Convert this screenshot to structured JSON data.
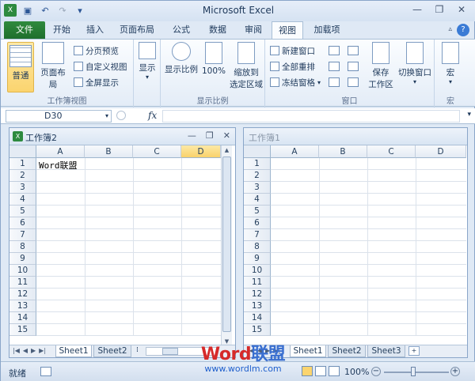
{
  "window": {
    "title": "Microsoft Excel"
  },
  "quick_access": {
    "save_icon": "save-icon",
    "undo_icon": "undo-icon",
    "redo_icon": "redo-icon",
    "customize_icon": "customize-qat-icon"
  },
  "ribbon_tabs": [
    {
      "label": "文件",
      "type": "file"
    },
    {
      "label": "开始"
    },
    {
      "label": "插入"
    },
    {
      "label": "页面布局"
    },
    {
      "label": "公式"
    },
    {
      "label": "数据"
    },
    {
      "label": "审阅"
    },
    {
      "label": "视图",
      "active": true
    },
    {
      "label": "加载项"
    }
  ],
  "ribbon": {
    "workbook_views": {
      "label": "工作簿视图",
      "normal": "普通",
      "page_layout": "页面布局",
      "page_break": "分页预览",
      "custom_view": "自定义视图",
      "full_screen": "全屏显示"
    },
    "show": {
      "label": "显示"
    },
    "zoom": {
      "label": "显示比例",
      "zoom": "显示比例",
      "hundred": "100%",
      "zoom_selection_line1": "缩放到",
      "zoom_selection_line2": "选定区域"
    },
    "window": {
      "label": "窗口",
      "new_window": "新建窗口",
      "arrange_all": "全部重排",
      "freeze_panes": "冻结窗格",
      "save_workspace_line1": "保存",
      "save_workspace_line2": "工作区",
      "switch_windows": "切换窗口"
    },
    "macros": {
      "label": "宏",
      "macros": "宏"
    }
  },
  "formula_bar": {
    "name_box": "D30",
    "fx": "fx",
    "content": ""
  },
  "workbooks": [
    {
      "title": "工作簿2",
      "active": true,
      "columns": [
        "A",
        "B",
        "C",
        "D"
      ],
      "selected_column": "D",
      "rows": [
        "1",
        "2",
        "3",
        "4",
        "5",
        "6",
        "7",
        "8",
        "9",
        "10",
        "11",
        "12",
        "13",
        "14",
        "15"
      ],
      "a1": "Word联盟",
      "sheets": [
        "Sheet1",
        "Sheet2"
      ],
      "active_sheet": "Sheet1"
    },
    {
      "title": "工作簿1",
      "active": false,
      "columns": [
        "A",
        "B",
        "C",
        "D"
      ],
      "rows": [
        "1",
        "2",
        "3",
        "4",
        "5",
        "6",
        "7",
        "8",
        "9",
        "10",
        "11",
        "12",
        "13",
        "14",
        "15"
      ],
      "sheets": [
        "Sheet1",
        "Sheet2",
        "Sheet3"
      ],
      "active_sheet": "Sheet1"
    }
  ],
  "status_bar": {
    "ready": "就绪",
    "zoom": "100%",
    "zoom_minus": "−",
    "zoom_plus": "+"
  },
  "watermark": {
    "brand_red": "Word",
    "brand_blue": "联盟",
    "url": "www.wordlm.com"
  }
}
